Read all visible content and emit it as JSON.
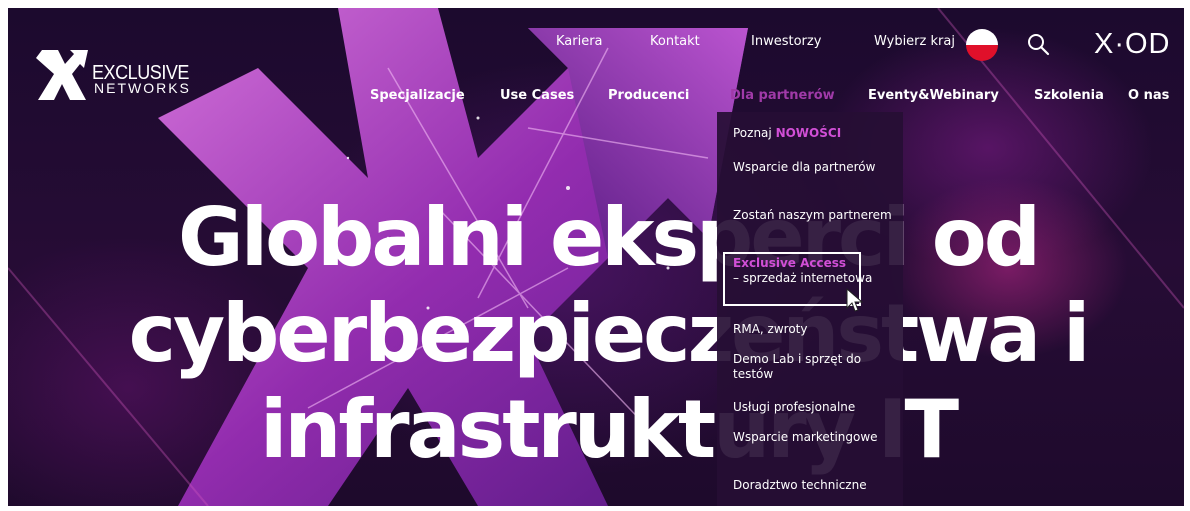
{
  "logo": {
    "line1": "EXCLUSIVE",
    "line2": "NETWORKS"
  },
  "top_nav": {
    "kariera": "Kariera",
    "kontakt": "Kontakt",
    "inwestorzy": "Inwestorzy",
    "country": "Wybierz kraj",
    "brand_right": "X·OD"
  },
  "main_nav": {
    "items": [
      "Specjalizacje",
      "Use Cases",
      "Producenci",
      "Dla partnerów",
      "Eventy&Webinary",
      "Szkolenia",
      "O nas"
    ],
    "active_index": 3
  },
  "hero": {
    "line1": "Globalni eksperci od",
    "line2": "cyberbezpieczeństwa i",
    "line3": "infrastruktury IT"
  },
  "dropdown": {
    "poznaj_prefix": "Poznaj ",
    "poznaj_accent": "NOWOŚCI",
    "items": [
      "Wsparcie dla partnerów",
      "Zostań naszym partnerem",
      "RMA, zwroty",
      "Demo Lab i sprzęt do testów",
      "Usługi profesjonalne",
      "Wsparcie marketingowe",
      "Doradztwo techniczne"
    ],
    "exclusive_accent": "Exclusive Access",
    "exclusive_rest": "– sprzedaż internetowa"
  },
  "colors": {
    "accent": "#d14fd6",
    "active_nav": "#a03aa8",
    "background": "#1c0a2e",
    "flag_red": "#e0102a"
  }
}
